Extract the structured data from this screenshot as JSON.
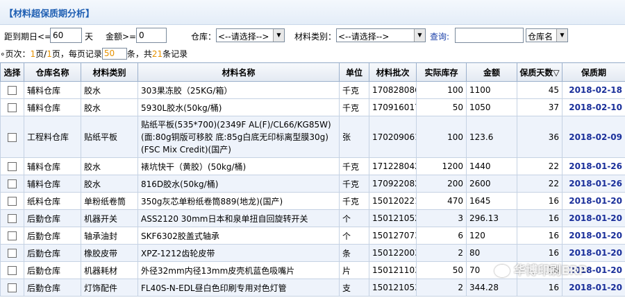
{
  "title": "【材料超保质期分析】",
  "filters": {
    "expiry_label": "距到期日<=",
    "expiry_value": "60",
    "expiry_unit": "天",
    "amount_label": "金额>=",
    "amount_value": "0",
    "warehouse_label": "仓库：",
    "warehouse_select": "<--请选择-->",
    "category_label": "材料类别：",
    "category_select": "<--请选择-->",
    "query_label": "查询:",
    "query_value": "",
    "query_field_select": "仓库名"
  },
  "pager": {
    "prefix": "∘页次：",
    "current": "1",
    "sep": "页/",
    "total": "1",
    "mid": "页，每页记录",
    "page_size": "50",
    "suffix1": "条，共",
    "total_records": "21",
    "suffix2": "条记录"
  },
  "table": {
    "headers": [
      "选择",
      "仓库名称",
      "材料类别",
      "材料名称",
      "单位",
      "材料批次",
      "实际库存",
      "金额",
      "保质天数▽",
      "保质期"
    ],
    "rows": [
      {
        "warehouse": "辅料仓库",
        "category": "胶水",
        "name": "303果冻胶（25KG/箱）",
        "unit": "千克",
        "batch": "170828086",
        "stock": "100",
        "amount": "1100",
        "days": "45",
        "expiry": "2018-02-18"
      },
      {
        "warehouse": "辅料仓库",
        "category": "胶水",
        "name": "5930L胶水(50kg/桶)",
        "unit": "千克",
        "batch": "170916017",
        "stock": "50",
        "amount": "1050",
        "days": "37",
        "expiry": "2018-02-10"
      },
      {
        "warehouse": "工程料仓库",
        "category": "贴纸平板",
        "name": "贴纸平板(535*700)(2349F AL(F)/CL66/KG85W)(面:80g铜版可移胶 底:85g白底无印标离型膜30g)(FSC Mix Credit)(国产)",
        "unit": "张",
        "batch": "170209061",
        "stock": "100",
        "amount": "123.6",
        "days": "36",
        "expiry": "2018-02-09"
      },
      {
        "warehouse": "辅料仓库",
        "category": "胶水",
        "name": "裱坑快干（黄胶）(50kg/桶)",
        "unit": "千克",
        "batch": "171228042",
        "stock": "1200",
        "amount": "1440",
        "days": "22",
        "expiry": "2018-01-26"
      },
      {
        "warehouse": "辅料仓库",
        "category": "胶水",
        "name": "816D胶水(50kg/桶)",
        "unit": "千克",
        "batch": "170922082",
        "stock": "200",
        "amount": "2600",
        "days": "22",
        "expiry": "2018-01-26"
      },
      {
        "warehouse": "纸料仓库",
        "category": "单粉纸卷筒",
        "name": "350g灰芯单粉纸卷筒889(地龙)(国产)",
        "unit": "千克",
        "batch": "150120221",
        "stock": "470",
        "amount": "1645",
        "days": "16",
        "expiry": "2018-01-20"
      },
      {
        "warehouse": "后勤仓库",
        "category": "机器开关",
        "name": "ASS2120 30mm日本和泉单扭自回旋转开关",
        "unit": "个",
        "batch": "150121052",
        "stock": "3",
        "amount": "296.13",
        "days": "16",
        "expiry": "2018-01-20"
      },
      {
        "warehouse": "后勤仓库",
        "category": "轴承油封",
        "name": "SKF6302胶盖式轴承",
        "unit": "个",
        "batch": "150127073",
        "stock": "6",
        "amount": "120",
        "days": "16",
        "expiry": "2018-01-20"
      },
      {
        "warehouse": "后勤仓库",
        "category": "橡胶皮带",
        "name": "XPZ-1212齿轮皮带",
        "unit": "条",
        "batch": "150122003",
        "stock": "2",
        "amount": "80",
        "days": "16",
        "expiry": "2018-01-20"
      },
      {
        "warehouse": "后勤仓库",
        "category": "机器耗材",
        "name": "外径32mm内径13mm皮壳机蓝色吸嘴片",
        "unit": "片",
        "batch": "150121103",
        "stock": "50",
        "amount": "70",
        "days": "16",
        "expiry": "2018-01-20"
      },
      {
        "warehouse": "后勤仓库",
        "category": "灯饰配件",
        "name": "FL40S-N-EDL昼白色印刷专用对色灯管",
        "unit": "支",
        "batch": "150121053",
        "stock": "2",
        "amount": "344.28",
        "days": "16",
        "expiry": "2018-01-20"
      }
    ]
  },
  "watermark": "华博印刷ERP",
  "colors": {
    "title": "#1f5fb3",
    "date": "#1a2f9a",
    "highlight_num": "#e69200",
    "row_alt": "#eef3fb"
  }
}
